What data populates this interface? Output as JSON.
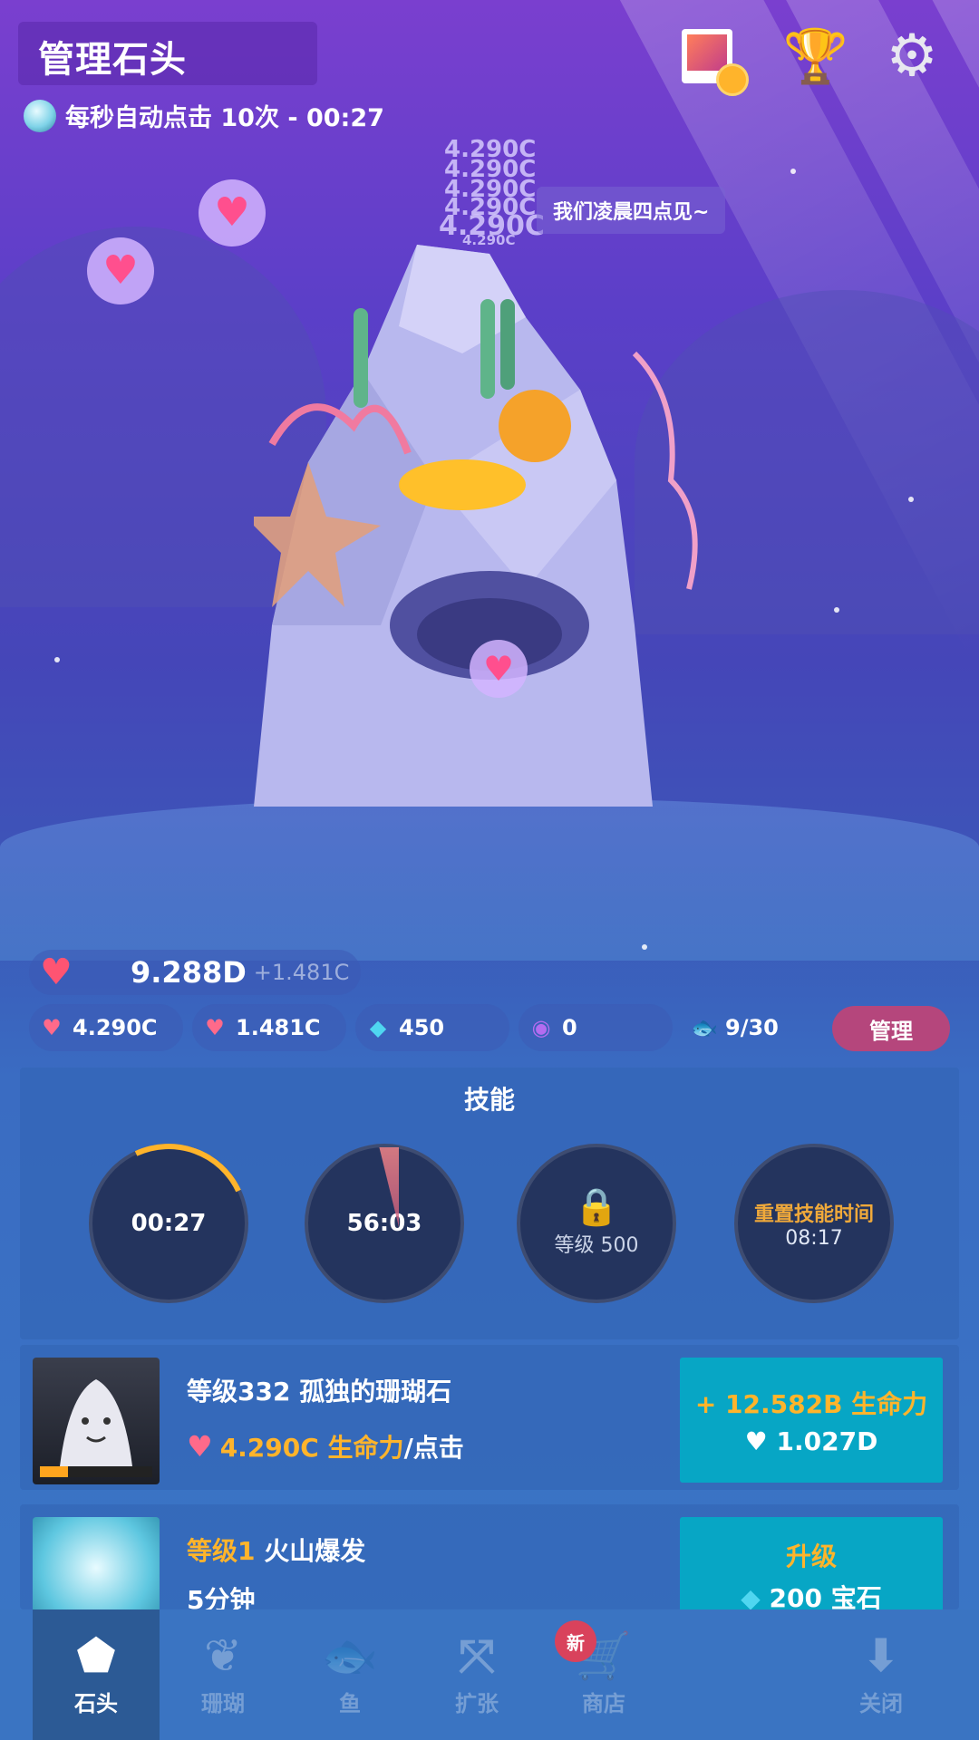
{
  "header": {
    "title": "管理石头",
    "auto_click_text": "每秒自动点击 10次 - 00:27"
  },
  "scene": {
    "speech": "我们凌晨四点见~",
    "floating_values": [
      "4.290C",
      "4.290C",
      "4.290C",
      "4.290C",
      "4.290C",
      "4.290C"
    ]
  },
  "stats": {
    "life_total": "9.288D",
    "life_rate": "+1.481C",
    "per_click": "4.290C",
    "per_second": "1.481C",
    "gems": "450",
    "pearls": "0",
    "fish": "9/30",
    "manage_label": "管理"
  },
  "skills": {
    "title": "技能",
    "items": [
      {
        "time": "00:27"
      },
      {
        "time": "56:03"
      },
      {
        "level": "等级 500"
      },
      {
        "reset_label": "重置技能时间",
        "time": "08:17"
      }
    ]
  },
  "cards": [
    {
      "name": "等级332 孤独的珊瑚石",
      "stat_value": "4.290C 生命力",
      "stat_suffix": "/点击",
      "action_line1": "+ 12.582B 生命力",
      "action_line2": "1.027D",
      "progress": 0.25
    },
    {
      "level": "等级1",
      "name": "火山爆发",
      "duration": "5分钟",
      "action_line1": "升级",
      "action_line2": "200 宝石"
    }
  ],
  "nav": {
    "items": [
      {
        "label": "石头",
        "icon": "rock-icon"
      },
      {
        "label": "珊瑚",
        "icon": "coral-icon"
      },
      {
        "label": "鱼",
        "icon": "fish-icon"
      },
      {
        "label": "扩张",
        "icon": "expand-icon"
      },
      {
        "label": "商店",
        "icon": "cart-icon"
      },
      {
        "label": "关闭",
        "icon": "download-icon"
      }
    ],
    "new_badge": "新"
  },
  "colors": {
    "accent_orange": "#ffb42b",
    "action_cyan": "#07a6c5",
    "manage_pink": "#b5467c"
  }
}
